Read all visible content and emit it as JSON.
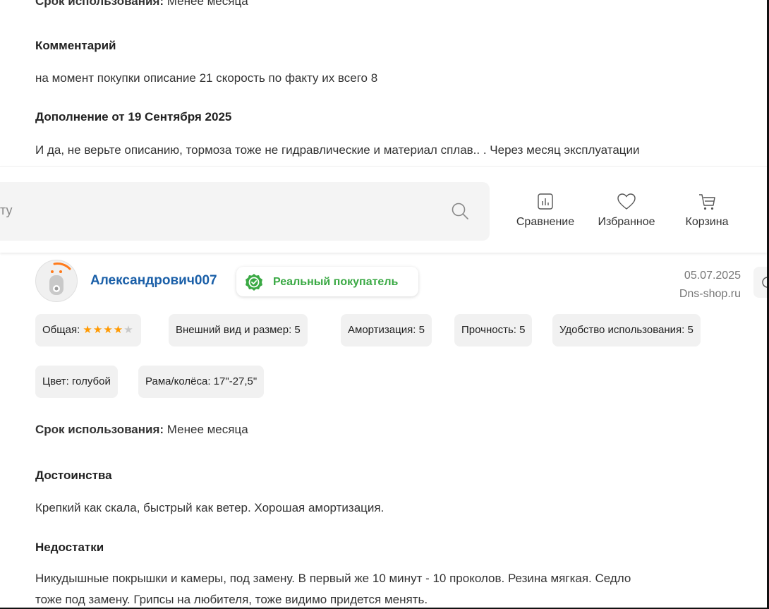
{
  "top_section": {
    "usage_label": "Срок использования:",
    "usage_value": "Менее месяца",
    "comment_heading": "Комментарий",
    "comment_text": "на момент покупки описание 21 скорость по факту их всего 8",
    "addition_heading": "Дополнение от 19 Сентября 2025",
    "addition_text": "И да, не верьте описанию, тормоза тоже не гидравлические и материал сплав.. . Через месяц эксплуатации"
  },
  "header": {
    "search_placeholder_fragment": "ту",
    "compare_label": "Сравнение",
    "favorites_label": "Избранное",
    "cart_label": "Корзина"
  },
  "review": {
    "username": "Александрович007",
    "badge": "Реальный покупатель",
    "date": "05.07.2025",
    "source": "Dns-shop.ru",
    "overall_label": "Общая:",
    "overall_rating": 4,
    "overall_max": 5,
    "ratings": [
      {
        "label": "Внешний вид и размер: 5"
      },
      {
        "label": "Амортизация: 5"
      },
      {
        "label": "Прочность: 5"
      },
      {
        "label": "Удобство использования: 5"
      }
    ],
    "specs": [
      {
        "label": "Цвет: голубой"
      },
      {
        "label": "Рама/колёса: 17\"-27,5\""
      }
    ],
    "usage_label": "Срок использования:",
    "usage_value": "Менее месяца",
    "pros_heading": "Достоинства",
    "pros_text": "Крепкий как скала, быстрый как ветер. Хорошая амортизация.",
    "cons_heading": "Недостатки",
    "cons_text_1": "Никудышные покрышки и камеры, под замену. В первый же 10 минут - 10 проколов. Резина мягкая. Седло",
    "cons_text_2": "тоже под замену. Грипсы на любителя, тоже видимо придется менять."
  },
  "colors": {
    "accent_link": "#1a5fa8",
    "badge_green": "#3aa944",
    "star": "#ff9900"
  }
}
